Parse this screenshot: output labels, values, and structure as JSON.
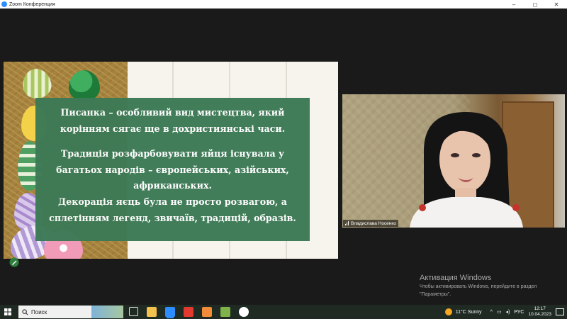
{
  "window": {
    "title": "Zoom Конференция",
    "controls": {
      "minimize": "–",
      "maximize": "◻",
      "close": "✕"
    }
  },
  "slide": {
    "paragraph1": "Писанка – особливий вид мистецтва, який корінням сягає ще в дохристиянські часи.",
    "paragraph2_line1": "Традиція розфарбовувати яйця існувала у багатьох народів – європейських, азійських, африканських.",
    "paragraph2_line2": "Декорація яєць була не просто розвагою, а сплетінням легенд, звичаїв, традицій, образів.",
    "card_color": "#3d7a56"
  },
  "participant": {
    "name": "Владислава Носенко"
  },
  "watermark": {
    "title": "Активация Windows",
    "line1": "Чтобы активировать Windows, перейдите в раздел",
    "line2": "\"Параметры\"."
  },
  "taskbar": {
    "search_placeholder": "Поиск",
    "weather": "11°C  Sunny",
    "language": "РУС",
    "time": "12:17",
    "date": "10.04.2023",
    "apps": [
      "task-view",
      "file-explorer",
      "zoom",
      "yandex",
      "app-orange",
      "app-green",
      "yandex-browser"
    ]
  }
}
